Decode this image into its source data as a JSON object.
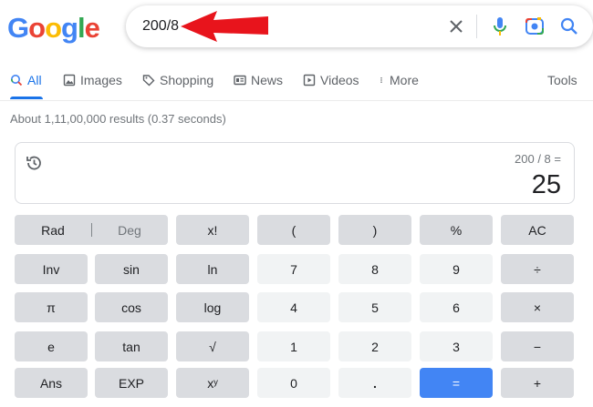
{
  "logo": {
    "letters": [
      "G",
      "o",
      "o",
      "g",
      "l",
      "e"
    ],
    "colors": [
      "#4285f4",
      "#ea4335",
      "#fbbc05",
      "#4285f4",
      "#34a853",
      "#ea4335"
    ]
  },
  "search": {
    "query": "200/8"
  },
  "tabs": [
    {
      "label": "All",
      "icon": "search-icon"
    },
    {
      "label": "Images",
      "icon": "image-icon"
    },
    {
      "label": "Shopping",
      "icon": "tag-icon"
    },
    {
      "label": "News",
      "icon": "news-icon"
    },
    {
      "label": "Videos",
      "icon": "play-icon"
    },
    {
      "label": "More",
      "icon": "more-vert-icon"
    },
    {
      "label": "Tools"
    }
  ],
  "stats": "About 1,11,00,000 results (0.37 seconds)",
  "calculator": {
    "expression": "200 / 8 =",
    "result": "25",
    "rad": "Rad",
    "deg": "Deg",
    "keys": {
      "fact": "x!",
      "lparen": "(",
      "rparen": ")",
      "percent": "%",
      "ac": "AC",
      "inv": "Inv",
      "sin": "sin",
      "ln": "ln",
      "seven": "7",
      "eight": "8",
      "nine": "9",
      "divide": "÷",
      "pi": "π",
      "cos": "cos",
      "log": "log",
      "four": "4",
      "five": "5",
      "six": "6",
      "multiply": "×",
      "e": "e",
      "tan": "tan",
      "sqrt": "√",
      "one": "1",
      "two": "2",
      "three": "3",
      "minus": "−",
      "ans": "Ans",
      "exp": "EXP",
      "pow": "xʸ",
      "zero": "0",
      "dot": ".",
      "equals": "=",
      "plus": "+"
    }
  },
  "colors": {
    "accent": "#1a73e8",
    "arrow": "#e8141c",
    "equals_key": "#4285f4"
  }
}
